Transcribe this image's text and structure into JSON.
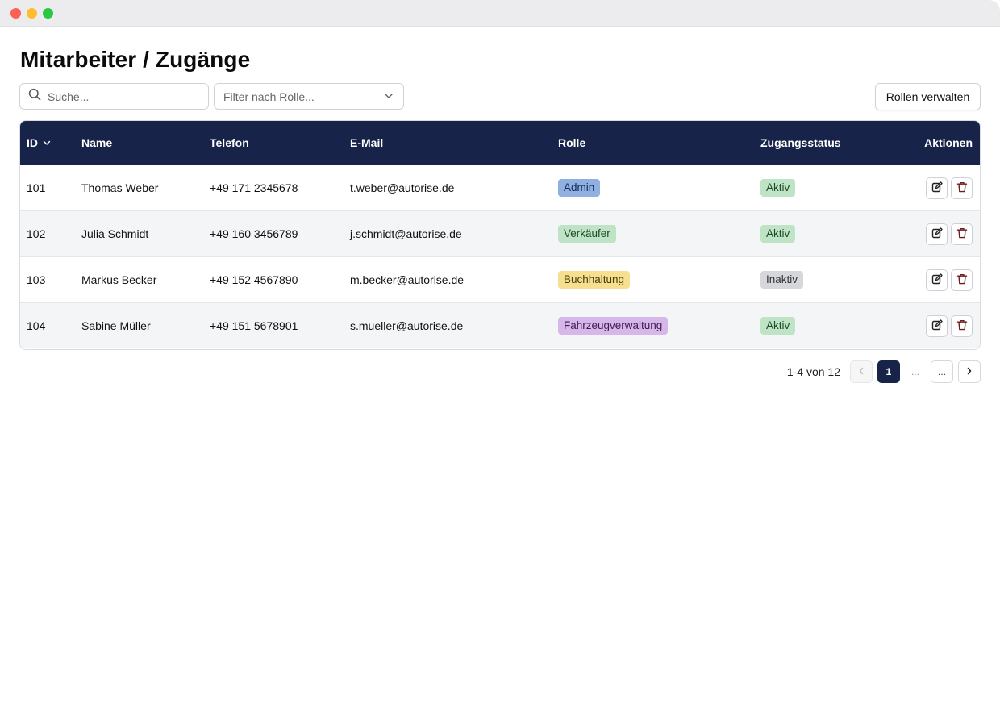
{
  "page": {
    "title": "Mitarbeiter / Zugänge"
  },
  "toolbar": {
    "search_placeholder": "Suche...",
    "role_filter_placeholder": "Filter nach Rolle...",
    "manage_roles_label": "Rollen verwalten"
  },
  "table": {
    "headers": {
      "id": "ID",
      "name": "Name",
      "phone": "Telefon",
      "email": "E-Mail",
      "role": "Rolle",
      "status": "Zugangsstatus",
      "actions": "Aktionen"
    },
    "rows": [
      {
        "id": "101",
        "name": "Thomas Weber",
        "phone": "+49 171 2345678",
        "email": "t.weber@autorise.de",
        "role": "Admin",
        "status": "Aktiv"
      },
      {
        "id": "102",
        "name": "Julia Schmidt",
        "phone": "+49 160 3456789",
        "email": "j.schmidt@autorise.de",
        "role": "Verkäufer",
        "status": "Aktiv"
      },
      {
        "id": "103",
        "name": "Markus Becker",
        "phone": "+49 152 4567890",
        "email": "m.becker@autorise.de",
        "role": "Buchhaltung",
        "status": "Inaktiv"
      },
      {
        "id": "104",
        "name": "Sabine Müller",
        "phone": "+49 151 5678901",
        "email": "s.mueller@autorise.de",
        "role": "Fahrzeugverwaltung",
        "status": "Aktiv"
      }
    ]
  },
  "pagination": {
    "info": "1-4 von 12",
    "current_page": "1",
    "gap": "...",
    "more": "..."
  },
  "colors": {
    "header_bg": "#172349",
    "role_admin": "#8fb0e0",
    "role_verkaeufer": "#bfe3c5",
    "role_buchhaltung": "#f6e08f",
    "role_fahrzeugverwaltung": "#d7b7ea",
    "status_aktiv": "#bfe3c5",
    "status_inaktiv": "#d6d7da"
  },
  "icons": {
    "search": "search-icon",
    "filter_dropdown": "chevron-down-icon",
    "sort": "chevron-down-icon",
    "edit": "edit-icon",
    "delete": "trash-icon",
    "prev": "chevron-left-icon",
    "next": "chevron-right-icon"
  }
}
